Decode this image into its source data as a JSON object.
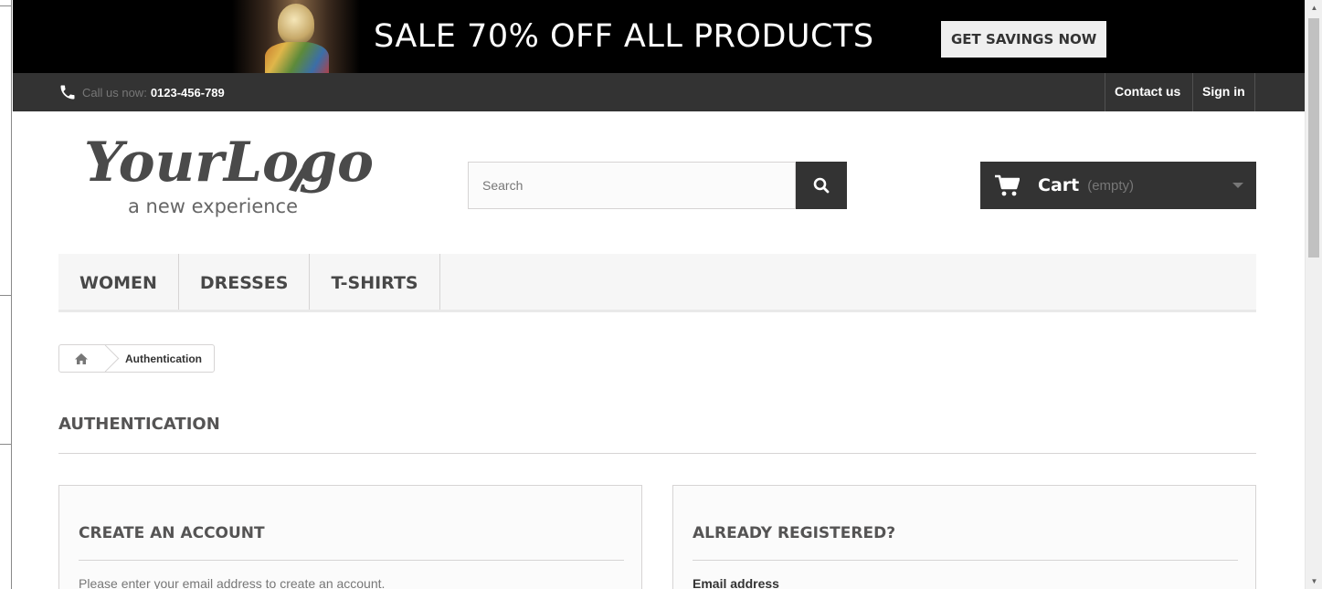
{
  "banner": {
    "headline": "SALE 70% OFF ALL PRODUCTS",
    "cta": "GET SAVINGS NOW"
  },
  "topbar": {
    "call_label": "Call us now:",
    "phone_number": "0123-456-789",
    "contact_label": "Contact us",
    "signin_label": "Sign in"
  },
  "header": {
    "logo_text": "YourLogo",
    "logo_tagline": "a new experience",
    "search_placeholder": "Search",
    "cart_label": "Cart",
    "cart_status": "(empty)"
  },
  "menu": {
    "items": [
      {
        "label": "WOMEN"
      },
      {
        "label": "DRESSES"
      },
      {
        "label": "T-SHIRTS"
      }
    ]
  },
  "breadcrumb": {
    "current": "Authentication"
  },
  "page": {
    "heading": "AUTHENTICATION"
  },
  "create_account": {
    "title": "CREATE AN ACCOUNT",
    "instructions": "Please enter your email address to create an account."
  },
  "login": {
    "title": "ALREADY REGISTERED?",
    "email_label": "Email address"
  },
  "colors": {
    "dark_bar": "#333333",
    "banner_bg": "#000000",
    "menu_bg": "#f6f6f6",
    "border": "#d6d4d4"
  },
  "icons": {
    "phone": "phone-icon",
    "search": "search-icon",
    "cart": "cart-icon",
    "home": "home-icon"
  }
}
